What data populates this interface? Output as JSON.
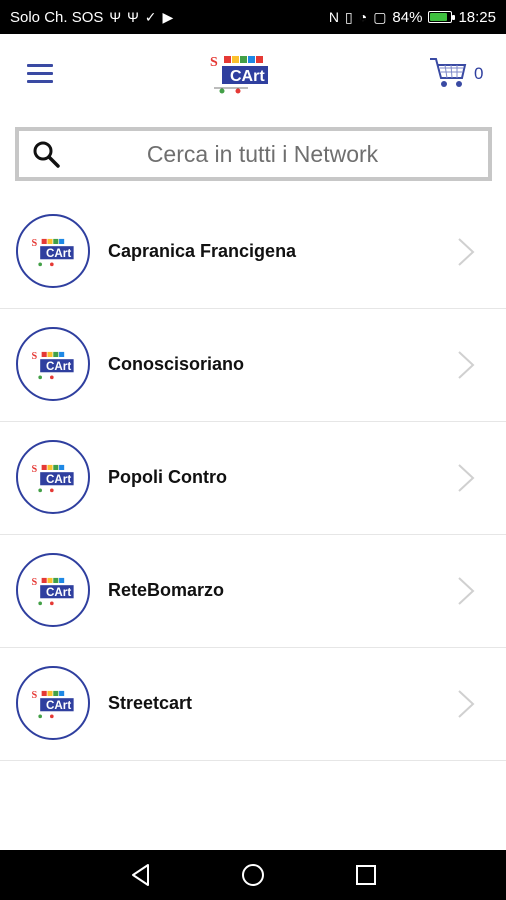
{
  "status_bar": {
    "carrier": "Solo Ch. SOS",
    "battery_text": "84%",
    "battery_level": 0.84,
    "time": "18:25"
  },
  "app_bar": {
    "logo_text_top": "Smart",
    "logo_text_bottom": "Cart",
    "cart_count": "0"
  },
  "search": {
    "placeholder": "Cerca in tutti i Network"
  },
  "networks": [
    {
      "label": "Capranica Francigena"
    },
    {
      "label": "Conoscisoriano"
    },
    {
      "label": "Popoli Contro"
    },
    {
      "label": "ReteBomarzo"
    },
    {
      "label": "Streetcart"
    }
  ],
  "colors": {
    "accent": "#2f3f9f",
    "status_bar_bg": "#000000",
    "battery_fill": "#3fbf3f"
  },
  "icons": {
    "menu": "hamburger-icon",
    "cart": "cart-icon",
    "search": "search-icon",
    "chevron": "chevron-right-icon",
    "nav_back": "back-triangle-icon",
    "nav_home": "home-circle-icon",
    "nav_recent": "recent-square-icon"
  }
}
